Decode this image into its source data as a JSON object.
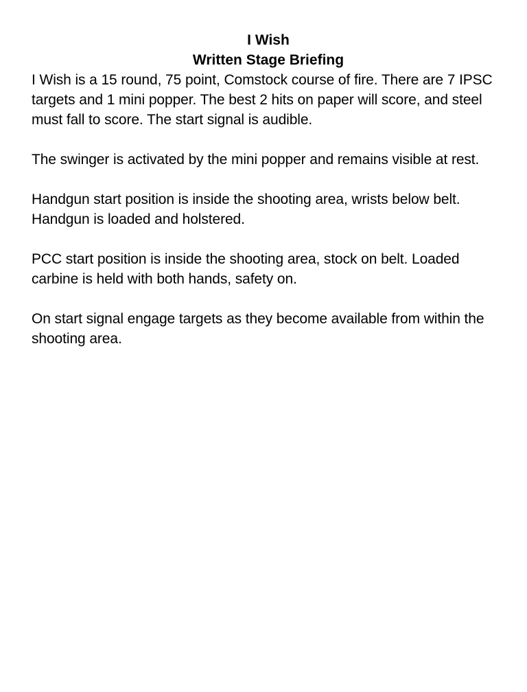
{
  "document": {
    "title": "I Wish",
    "subtitle": "Written Stage Briefing",
    "paragraphs": [
      "I Wish is a 15 round, 75 point, Comstock course of fire. There are 7 IPSC targets and 1 mini popper. The best 2 hits on paper will score, and steel must fall to score. The start signal is audible.",
      "The swinger is activated by the mini popper and remains visible at rest.",
      "Handgun start position is inside the shooting area, wrists below belt. Handgun is loaded and holstered.",
      "PCC start position is inside the shooting area, stock on belt. Loaded carbine is held with both hands, safety on.",
      "On start signal engage targets as they become available from within the shooting area."
    ]
  }
}
